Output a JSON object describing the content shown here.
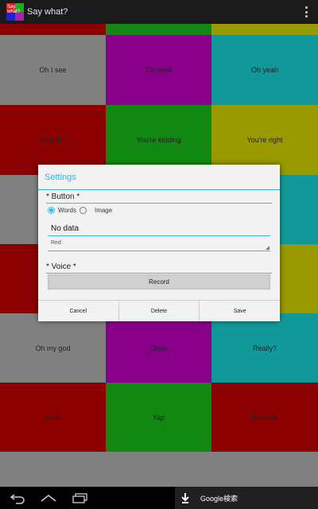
{
  "app": {
    "title": "Say what?",
    "icon_text": "Say what?"
  },
  "colors": {
    "gray": "#808080",
    "purple": "#880088",
    "teal": "#119999",
    "red": "#8b0000",
    "green": "#118811",
    "olive": "#999900",
    "accent": "#33b5e5"
  },
  "grid": {
    "rows": [
      [
        "",
        "",
        ""
      ],
      [
        "Oh I see",
        "Oh wow",
        "Oh yeah"
      ],
      [
        "Oh huh?",
        "You're kidding",
        "You're right"
      ],
      [
        "",
        "",
        ""
      ],
      [
        "",
        "",
        ""
      ],
      [
        "Oh my god",
        "Oops",
        "Really?"
      ],
      [
        "Wow",
        "Yap",
        "No data"
      ]
    ]
  },
  "dialog": {
    "title": "Settings",
    "button_section": "* Button *",
    "radio_words": "Words",
    "radio_image": "Image",
    "text_value": "No data",
    "color_selected": "Red",
    "voice_section": "* Voice *",
    "record_label": "Record",
    "cancel_label": "Cancel",
    "delete_label": "Delete",
    "save_label": "Save"
  },
  "navbar": {
    "google_label": "Google検索"
  }
}
